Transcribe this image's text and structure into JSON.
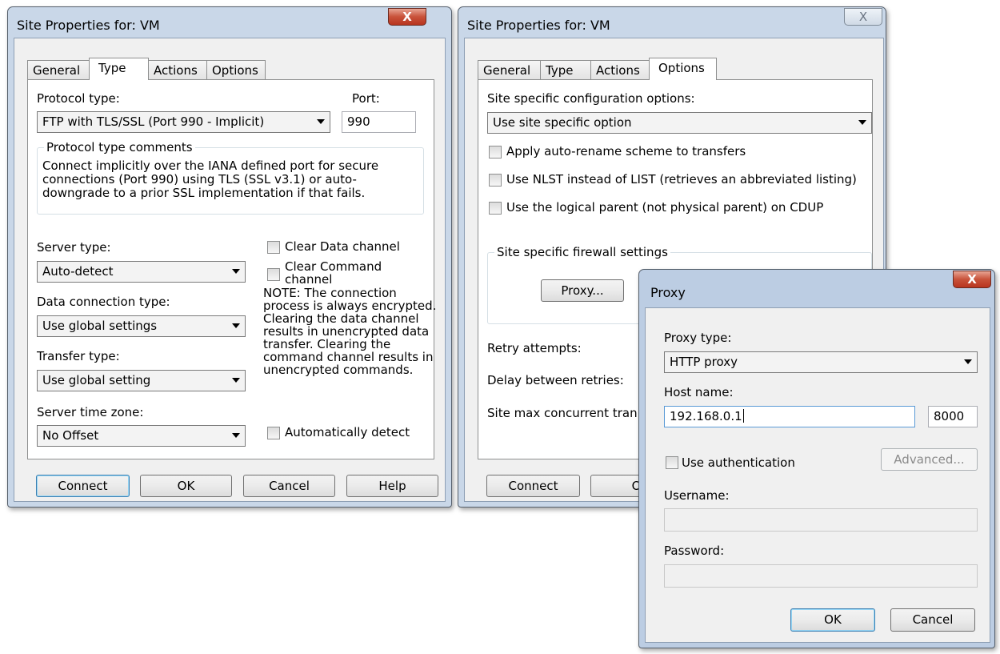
{
  "dialog1": {
    "title": "Site Properties for: VM",
    "close_label": "X",
    "tabs": [
      "General",
      "Type",
      "Actions",
      "Options"
    ],
    "protocol_type_label": "Protocol type:",
    "protocol_type_value": "FTP with TLS/SSL (Port 990 - Implicit)",
    "port_label": "Port:",
    "port_value": "990",
    "comments_group_label": "Protocol type comments",
    "comments_text": "Connect implicitly over the IANA defined port for secure connections (Port 990) using TLS (SSL v3.1) or auto-downgrade to a prior SSL implementation if that fails.",
    "server_type_label": "Server type:",
    "server_type_value": "Auto-detect",
    "data_connection_label": "Data connection type:",
    "data_connection_value": "Use global settings",
    "transfer_type_label": "Transfer type:",
    "transfer_type_value": "Use global setting",
    "server_time_zone_label": "Server time zone:",
    "server_time_zone_value": "No Offset",
    "clear_data_label": "Clear Data channel",
    "clear_command_label": "Clear Command channel",
    "note_text": "NOTE: The connection process is always encrypted.  Clearing the data channel results in unencrypted data transfer.  Clearing the command channel results in unencrypted commands.",
    "auto_detect_label": "Automatically detect",
    "buttons": {
      "connect": "Connect",
      "ok": "OK",
      "cancel": "Cancel",
      "help": "Help"
    }
  },
  "dialog2": {
    "title": "Site Properties for: VM",
    "close_label": "X",
    "tabs": [
      "General",
      "Type",
      "Actions",
      "Options"
    ],
    "site_config_label": "Site specific configuration options:",
    "site_config_value": "Use site specific option",
    "opt_auto_rename": "Apply auto-rename scheme to transfers",
    "opt_nlst": "Use NLST instead of LIST (retrieves an abbreviated listing)",
    "opt_logical_parent": "Use the logical parent (not physical parent) on CDUP",
    "firewall_group_label": "Site specific firewall settings",
    "proxy_button": "Proxy...",
    "retry_label": "Retry attempts:",
    "delay_label": "Delay between retries:",
    "max_concurrent_label": "Site max concurrent tran",
    "connect_button": "Connect",
    "ok_partial": "O"
  },
  "proxy": {
    "title": "Proxy",
    "close_label": "X",
    "proxy_type_label": "Proxy type:",
    "proxy_type_value": "HTTP proxy",
    "host_label": "Host name:",
    "host_value": "192.168.0.1",
    "port_value": "8000",
    "use_auth_label": "Use authentication",
    "advanced_button": "Advanced...",
    "username_label": "Username:",
    "password_label": "Password:",
    "ok_button": "OK",
    "cancel_button": "Cancel"
  }
}
